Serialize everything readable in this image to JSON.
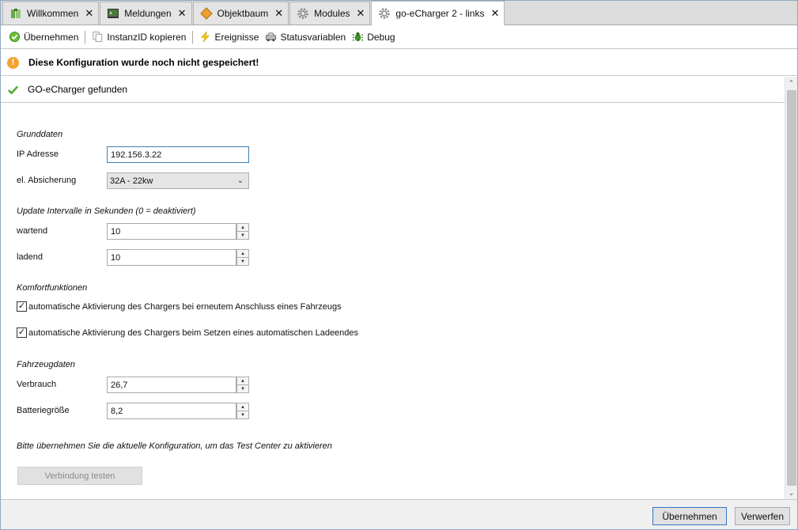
{
  "tabs": [
    {
      "label": "Willkommen",
      "icon": "puzzle-icon"
    },
    {
      "label": "Meldungen",
      "icon": "terminal-icon"
    },
    {
      "label": "Objektbaum",
      "icon": "diamond-icon"
    },
    {
      "label": "Modules",
      "icon": "gear-icon"
    },
    {
      "label": "go-eCharger 2 - links",
      "icon": "gear-icon",
      "active": true
    }
  ],
  "toolbar": {
    "apply": "Übernehmen",
    "copy_id": "InstanzID kopieren",
    "events": "Ereignisse",
    "status_vars": "Statusvariablen",
    "debug": "Debug"
  },
  "warning": "Diese Konfiguration wurde noch nicht gespeichert!",
  "found": "GO-eCharger gefunden",
  "form": {
    "section_basic": "Grunddaten",
    "ip_label": "IP Adresse",
    "ip_value": "192.156.3.22",
    "fuse_label": "el. Absicherung",
    "fuse_value": "32A - 22kw",
    "section_update": "Update Intervalle in Sekunden (0 = deaktiviert)",
    "waiting_label": "wartend",
    "waiting_value": "10",
    "charging_label": "ladend",
    "charging_value": "10",
    "section_comfort": "Komfortfunktionen",
    "comfort1": "automatische Aktivierung des Chargers bei erneutem Anschluss eines Fahrzeugs",
    "comfort2": "automatische Aktivierung des Chargers beim Setzen eines automatischen Ladeendes",
    "section_vehicle": "Fahrzeugdaten",
    "consumption_label": "Verbrauch",
    "consumption_value": "26,7",
    "battery_label": "Batteriegröße",
    "battery_value": "8,2",
    "hint": "Bitte übernehmen Sie die aktuelle Konfiguration, um das Test Center zu aktivieren",
    "test_button": "Verbindung testen"
  },
  "footer": {
    "apply": "Übernehmen",
    "discard": "Verwerfen"
  },
  "colors": {
    "accent": "#2f78c4",
    "warning": "#f2a32f",
    "success": "#4aa82b"
  }
}
